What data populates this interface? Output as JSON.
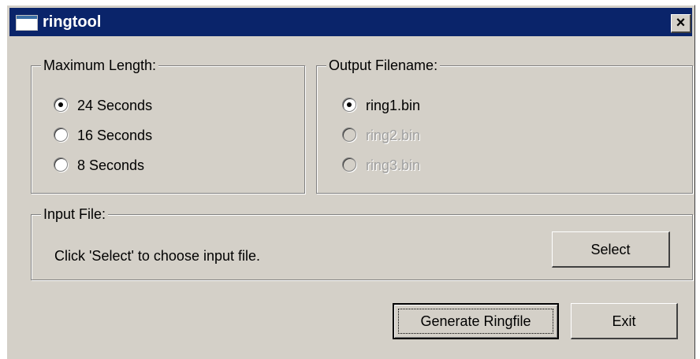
{
  "window": {
    "title": "ringtool",
    "close_label": "×"
  },
  "max_length": {
    "legend": "Maximum Length:",
    "options": [
      {
        "label": "24 Seconds",
        "selected": true,
        "enabled": true
      },
      {
        "label": "16 Seconds",
        "selected": false,
        "enabled": true
      },
      {
        "label": "8 Seconds",
        "selected": false,
        "enabled": true
      }
    ]
  },
  "output_filename": {
    "legend": "Output Filename:",
    "options": [
      {
        "label": "ring1.bin",
        "selected": true,
        "enabled": true
      },
      {
        "label": "ring2.bin",
        "selected": false,
        "enabled": false
      },
      {
        "label": "ring3.bin",
        "selected": false,
        "enabled": false
      }
    ]
  },
  "input_file": {
    "legend": "Input File:",
    "status_text": "Click 'Select' to choose input file.",
    "select_label": "Select"
  },
  "actions": {
    "generate_label": "Generate Ringfile",
    "exit_label": "Exit"
  }
}
